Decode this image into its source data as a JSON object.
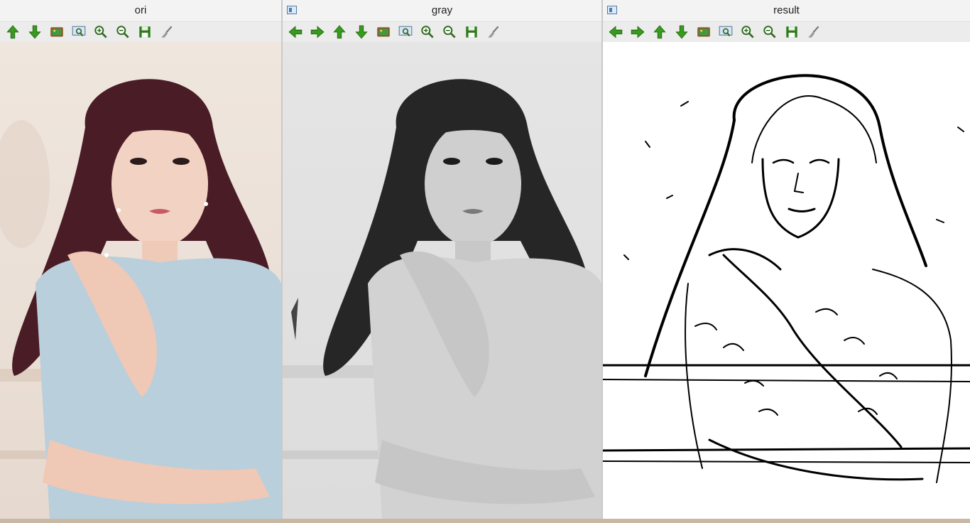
{
  "windows": {
    "ori": {
      "title": "ori"
    },
    "gray": {
      "title": "gray"
    },
    "result": {
      "title": "result"
    }
  },
  "toolbar_icons": [
    "arrow-left",
    "arrow-right",
    "arrow-up",
    "arrow-down",
    "image",
    "zoom-fit",
    "zoom-in",
    "zoom-out",
    "save",
    "properties"
  ],
  "colors": {
    "arrow_green": "#3a9a1f",
    "title_bar": "#f3f3f3",
    "toolbar": "#ececec",
    "hair_ori": "#4a1c26",
    "hair_gray": "#262626",
    "dress_ori": "#b9cfdc",
    "dress_gray": "#d2d2d2"
  }
}
